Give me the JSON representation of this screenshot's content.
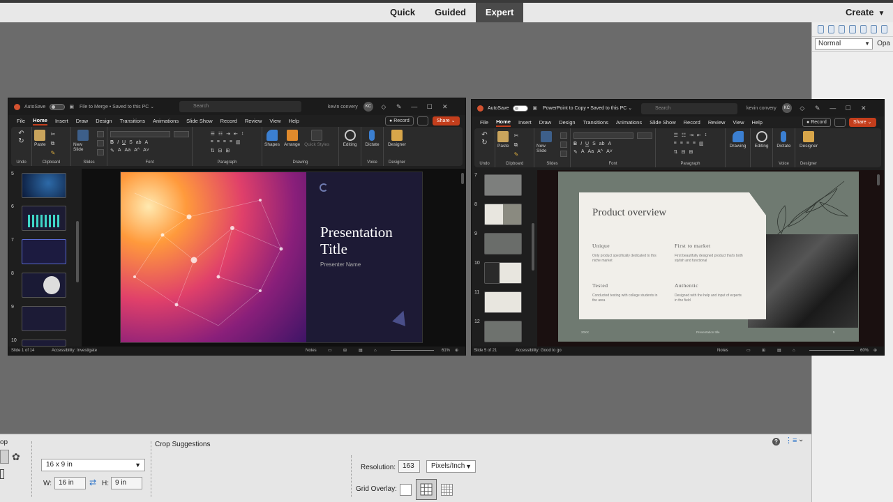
{
  "modes": [
    "Quick",
    "Guided",
    "Expert"
  ],
  "active_mode": "Expert",
  "create_label": "Create",
  "right_panel": {
    "blend_mode": "Normal",
    "opacity_label": "Opa"
  },
  "ppt_left": {
    "autosave_label": "AutoSave",
    "autosave_state": "Off",
    "doc_title": "File to Merge • Saved to this PC ⌄",
    "search_placeholder": "Search",
    "user_name": "kevin convery",
    "user_initials": "KC",
    "tabs": [
      "File",
      "Home",
      "Insert",
      "Draw",
      "Design",
      "Transitions",
      "Animations",
      "Slide Show",
      "Record",
      "Review",
      "View",
      "Help"
    ],
    "record_label": "Record",
    "share_label": "Share",
    "groups": [
      "Undo",
      "Clipboard",
      "Slides",
      "Font",
      "Paragraph",
      "Drawing",
      "Voice",
      "Designer"
    ],
    "buttons": [
      "Paste",
      "New Slide",
      "Shapes",
      "Arrange",
      "Quick Styles",
      "Editing",
      "Dictate",
      "Designer"
    ],
    "thumb_numbers": [
      "5",
      "6",
      "7",
      "8",
      "9",
      "10"
    ],
    "slide_title": "Presentation Title",
    "slide_subtitle": "Presenter Name",
    "status_left": "Slide 1 of 14",
    "status_accessibility": "Accessibility: Investigate",
    "status_notes": "Notes",
    "zoom": "61%"
  },
  "ppt_right": {
    "autosave_label": "AutoSave",
    "autosave_state": "Off",
    "doc_title": "PowerPoint to Copy • Saved to this PC ⌄",
    "search_placeholder": "Search",
    "user_name": "kevin convery",
    "user_initials": "KC",
    "tabs": [
      "File",
      "Home",
      "Insert",
      "Draw",
      "Design",
      "Transitions",
      "Animations",
      "Slide Show",
      "Record",
      "Review",
      "View",
      "Help"
    ],
    "record_label": "Record",
    "share_label": "Share",
    "groups": [
      "Undo",
      "Clipboard",
      "Slides",
      "Font",
      "Paragraph",
      "Voice",
      "Designer"
    ],
    "buttons": [
      "Paste",
      "New Slide",
      "Drawing",
      "Editing",
      "Dictate",
      "Designer"
    ],
    "thumb_numbers": [
      "7",
      "8",
      "9",
      "10",
      "11",
      "12"
    ],
    "slide": {
      "title": "Product overview",
      "blocks": [
        {
          "heading": "Unique",
          "text": "Only product specifically dedicated to this niche market"
        },
        {
          "heading": "First to market",
          "text": "First beautifully designed product that's both stylish and functional"
        },
        {
          "heading": "Tested",
          "text": "Conducted testing with college students in the area"
        },
        {
          "heading": "Authentic",
          "text": "Designed with the help and input of experts in the field"
        }
      ],
      "footer_left": "20XX",
      "footer_center": "Presentation title",
      "footer_right": "5"
    },
    "status_left": "Slide 5 of 21",
    "status_accessibility": "Accessibility: Good to go",
    "status_notes": "Notes",
    "zoom": "60%"
  },
  "tool_options": {
    "crop_label": "op",
    "crop_suggestions": "Crop Suggestions",
    "preset": "16 x 9 in",
    "w_label": "W:",
    "w_value": "16 in",
    "h_label": "H:",
    "h_value": "9 in",
    "resolution_label": "Resolution:",
    "resolution_value": "163",
    "resolution_unit": "Pixels/Inch",
    "grid_overlay_label": "Grid Overlay:"
  }
}
